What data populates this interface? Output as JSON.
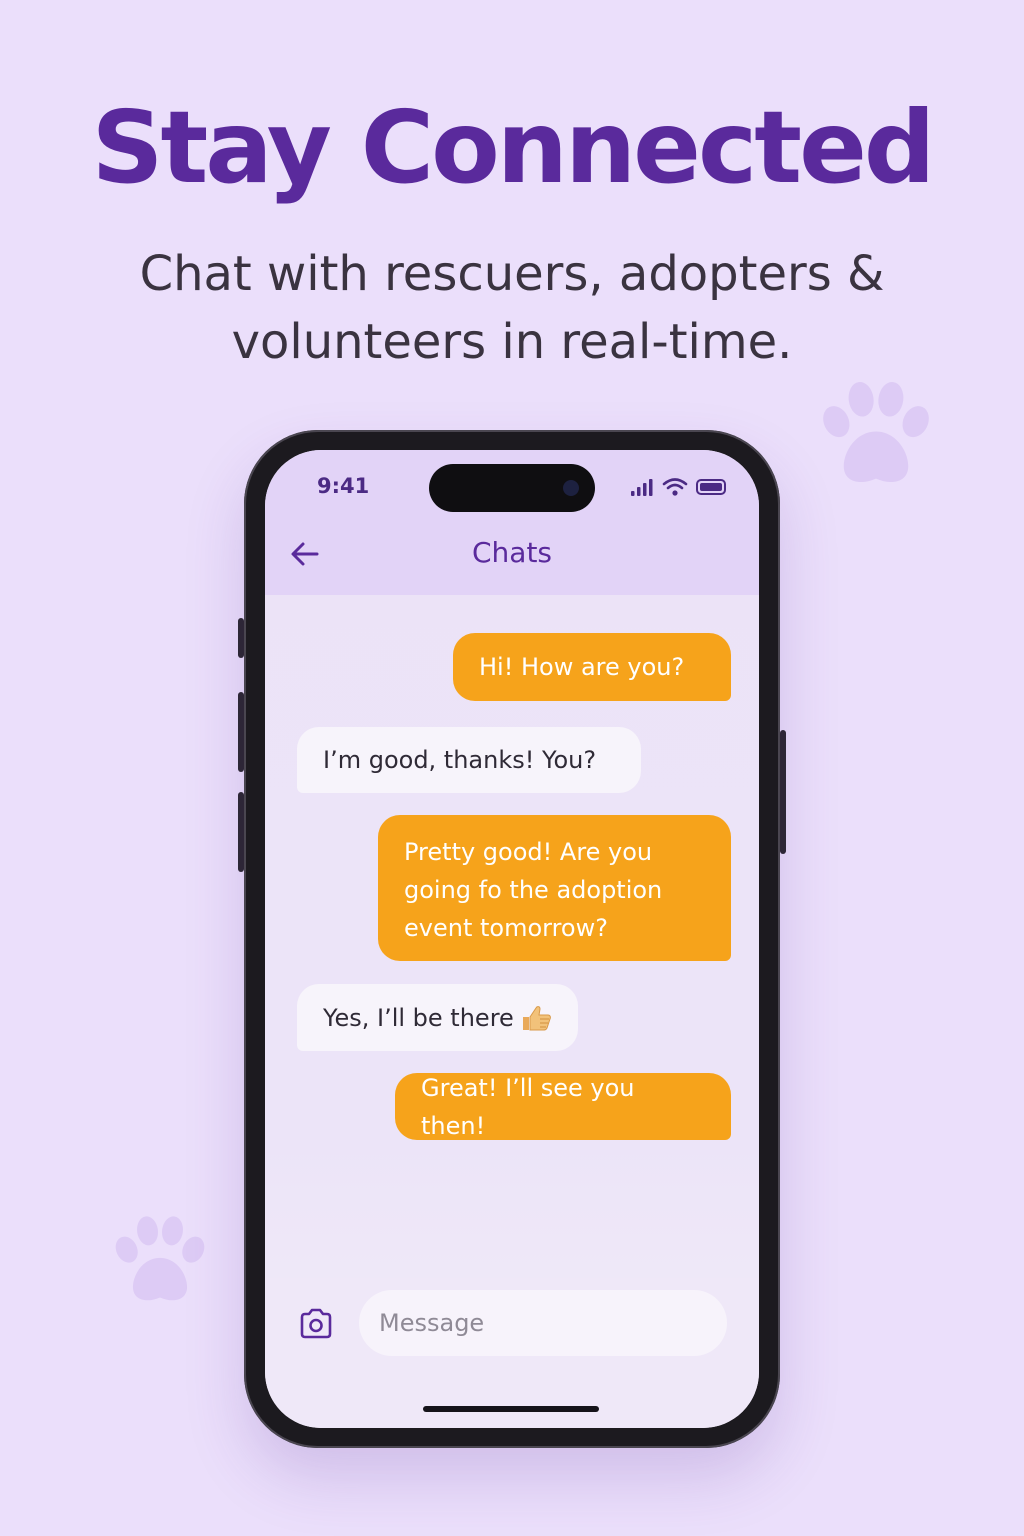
{
  "hero": {
    "title": "Stay Connected",
    "subtitle": "Chat with rescuers, adopters & volunteers in real-time."
  },
  "status_bar": {
    "time": "9:41"
  },
  "header": {
    "title": "Chats",
    "back_icon": "arrow-left-icon"
  },
  "messages": [
    {
      "direction": "outgoing",
      "text": "Hi! How are you?"
    },
    {
      "direction": "incoming",
      "text": "I’m good, thanks! You?"
    },
    {
      "direction": "outgoing",
      "text": "Pretty good! Are you going fo the adoption event tomorrow?"
    },
    {
      "direction": "incoming",
      "text": "Yes, I’ll be there",
      "emoji": "thumbs-up-emoji"
    },
    {
      "direction": "outgoing",
      "text": "Great! I’ll see you then!"
    }
  ],
  "composer": {
    "placeholder": "Message",
    "camera_icon": "camera-icon"
  },
  "colors": {
    "background": "#ebdffb",
    "brand_purple": "#5a2a9c",
    "outgoing_bubble": "#f6a31b",
    "incoming_bubble": "#f7f4fb",
    "header_bar": "#e2d3f7"
  }
}
